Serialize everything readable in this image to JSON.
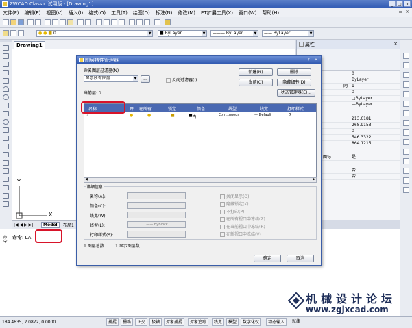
{
  "window": {
    "title": "ZWCAD Classic 试用版 - [Drawing1]"
  },
  "menu": [
    "文件(F)",
    "编辑(E)",
    "视图(V)",
    "插入(I)",
    "格式(O)",
    "工具(T)",
    "绘图(D)",
    "标注(N)",
    "修改(M)",
    "ET扩展工具(X)",
    "窗口(W)",
    "帮助(H)"
  ],
  "toolbar": {
    "layer_value": "0",
    "color_value": "ByLayer",
    "linetype_value": "ByLayer",
    "lineweight_value": "ByLayer"
  },
  "document": {
    "tab": "Drawing1",
    "axis_y": "Y",
    "axis_x": "X"
  },
  "layout_tabs": {
    "model": "Model",
    "layout1": "布局1"
  },
  "properties": {
    "title": "属性",
    "rows": [
      "0",
      "ByLayer",
      "1",
      "0",
      "ByLayer",
      "ByLayer",
      "213.6181",
      "268.9153",
      "0",
      "546.3322",
      "864.1215",
      "是",
      "否",
      "否"
    ],
    "row_label_visible": [
      "网",
      "图标"
    ]
  },
  "command": {
    "prompt": "命令: LA",
    "side_label": "命令"
  },
  "status": {
    "coords": "184.4635,  2.0872,  0.0000",
    "buttons": [
      "捕捉",
      "栅格",
      "正交",
      "极轴",
      "对象捕捉",
      "对象追踪",
      "线宽",
      "模型",
      "数字化仪",
      "动态输入",
      "就绪"
    ]
  },
  "dialog": {
    "title": "图层特性管理器",
    "filter_label": "命名图层过滤器(N)",
    "filter_value": "显示所有图层",
    "filter_browse": "...",
    "invert_filter": "反向过滤器(I)",
    "current_layer": "当前层: 0",
    "buttons": {
      "new": "新建(N)",
      "delete": "删除",
      "current": "当前(C)",
      "hide_details": "隐藏细节(D)",
      "state_manager": "状态管理器(E)..."
    },
    "columns": [
      "名称",
      "开",
      "在所有...",
      "锁定",
      "颜色",
      "线型",
      "线宽",
      "打印样式"
    ],
    "layers": [
      {
        "name": "0",
        "color": "白",
        "linetype": "Continuous",
        "lineweight": "— Default",
        "plotstyle": "7"
      }
    ],
    "details": {
      "title": "详细信息",
      "name_label": "名称(A):",
      "color_label": "颜色(C):",
      "lineweight_label": "线宽(W):",
      "linetype_label": "线型(L):",
      "linetype_value": "ByBlock",
      "plotstyle_label": "打印样式(S):",
      "options": [
        "关闭显示(O)",
        "隐藏锁定(K)",
        "不打印(P)",
        "在所有视口中冻结(Z)",
        "在当前视口中冻结(R)",
        "在新视口中冻结(V)"
      ]
    },
    "summary_total": "1 图层总数",
    "summary_shown": "1 显示图层数",
    "ok": "确定",
    "cancel": "取消"
  },
  "watermark": {
    "text": "机械设计论坛",
    "url": "www.zgjxcad.com"
  }
}
